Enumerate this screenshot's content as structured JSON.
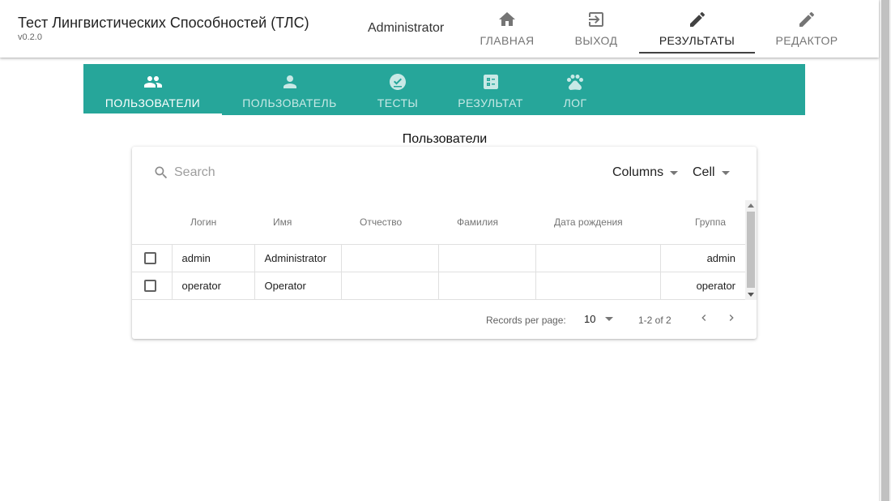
{
  "app": {
    "title": "Тест Лингвистических Способностей (ТЛС)",
    "version": "v0.2.0",
    "user": "Administrator"
  },
  "topnav": [
    {
      "label": "ГЛАВНАЯ",
      "icon": "home-icon"
    },
    {
      "label": "ВЫХОД",
      "icon": "logout-icon"
    },
    {
      "label": "РЕЗУЛЬТАТЫ",
      "icon": "pencil-icon",
      "active": true
    },
    {
      "label": "РЕДАКТОР",
      "icon": "pencil-icon"
    }
  ],
  "subtabs": [
    {
      "label": "ПОЛЬЗОВАТЕЛИ",
      "icon": "people-icon",
      "active": true
    },
    {
      "label": "ПОЛЬЗОВАТЕЛЬ",
      "icon": "person-icon"
    },
    {
      "label": "ТЕСТЫ",
      "icon": "check-circle-icon"
    },
    {
      "label": "РЕЗУЛЬТАТ",
      "icon": "list-box-icon"
    },
    {
      "label": "ЛОГ",
      "icon": "paw-icon"
    }
  ],
  "section_title": "Пользователи",
  "table": {
    "search_placeholder": "Search",
    "columns_label": "Columns",
    "cell_label": "Cell",
    "headers": [
      "Логин",
      "Имя",
      "Отчество",
      "Фамилия",
      "Дата рождения",
      "Группа"
    ],
    "rows": [
      [
        "admin",
        "Administrator",
        "",
        "",
        "",
        "admin"
      ],
      [
        "operator",
        "Operator",
        "",
        "",
        "",
        "operator"
      ]
    ],
    "records_per_page_label": "Records per page:",
    "records_per_page": "10",
    "range": "1-2 of 2"
  },
  "colors": {
    "accent": "#26a69a",
    "tab_text": "#ffffff",
    "nav_text": "#757575"
  }
}
